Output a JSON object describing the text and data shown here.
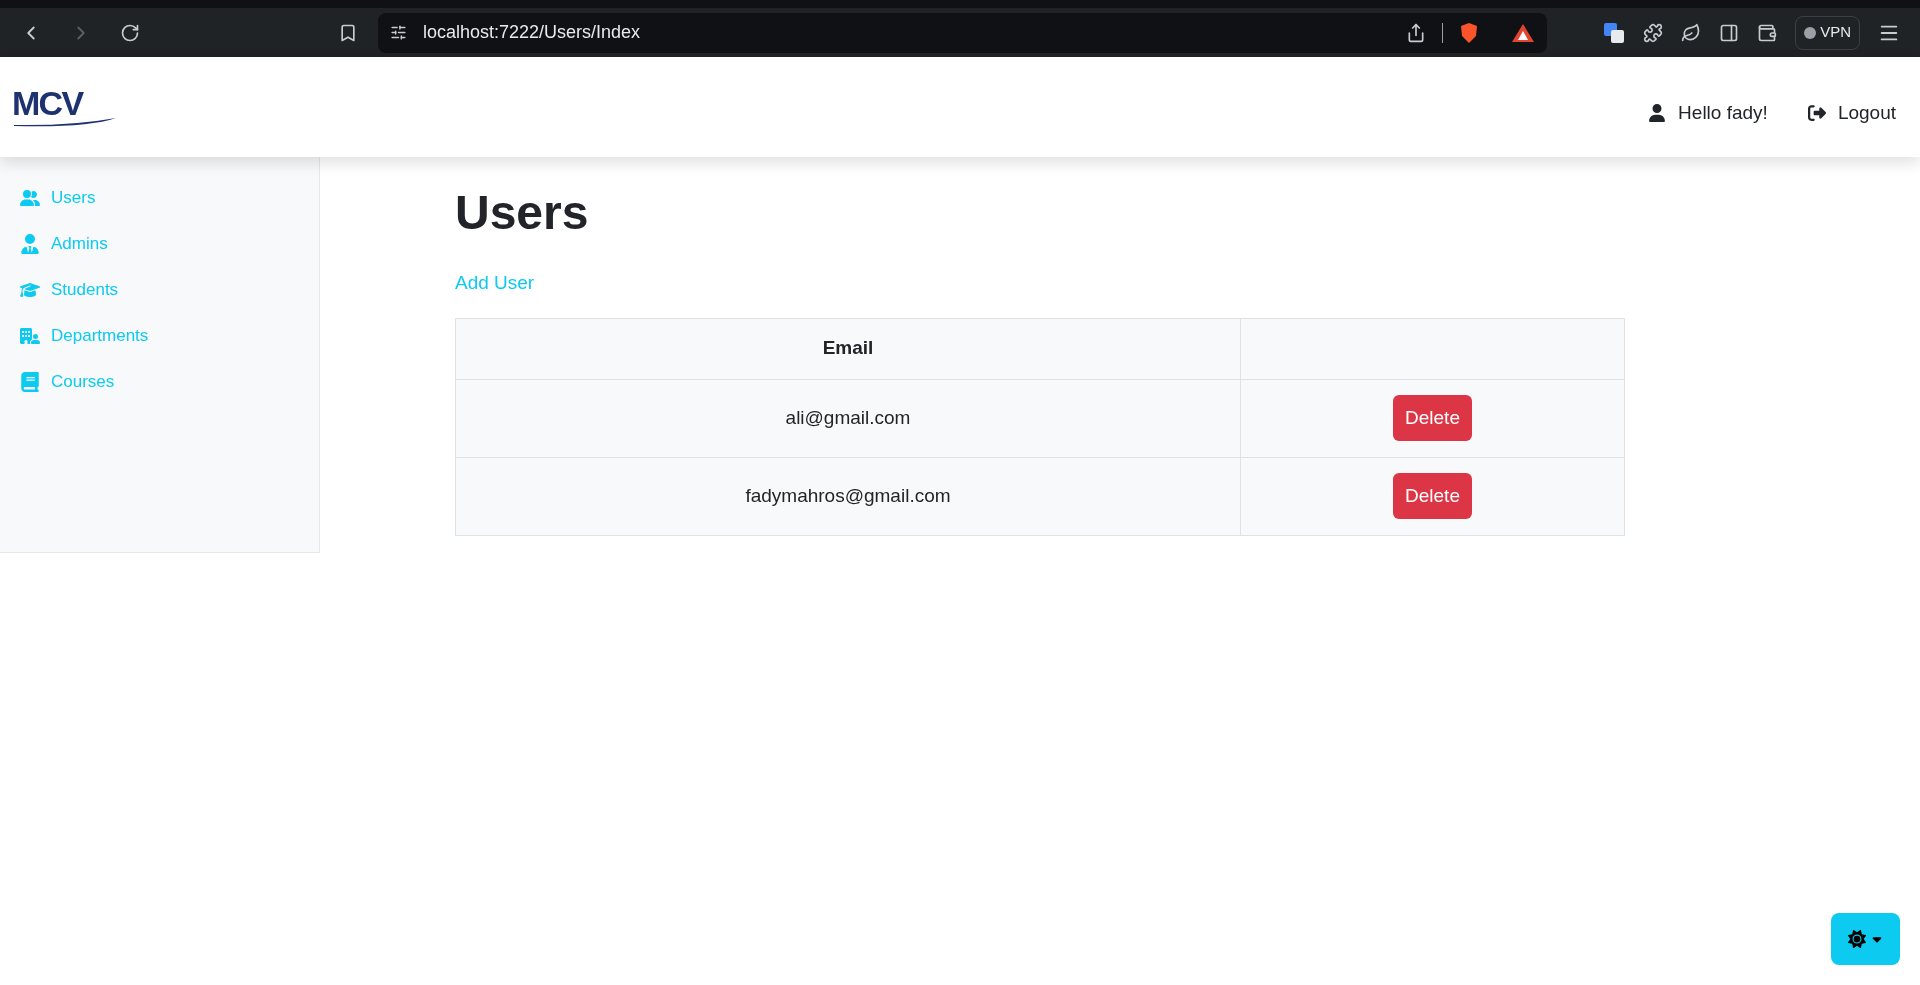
{
  "browser": {
    "url": "localhost:7222/Users/Index",
    "vpn": "VPN"
  },
  "header": {
    "logo": "MCV",
    "greeting": "Hello fady!",
    "logout": "Logout"
  },
  "sidebar": {
    "items": [
      {
        "label": "Users"
      },
      {
        "label": "Admins"
      },
      {
        "label": "Students"
      },
      {
        "label": "Departments"
      },
      {
        "label": "Courses"
      }
    ]
  },
  "page": {
    "title": "Users",
    "add_link": "Add User"
  },
  "table": {
    "columns": [
      "Email"
    ],
    "rows": [
      {
        "email": "ali@gmail.com",
        "action": "Delete"
      },
      {
        "email": "fadymahros@gmail.com",
        "action": "Delete"
      }
    ]
  }
}
